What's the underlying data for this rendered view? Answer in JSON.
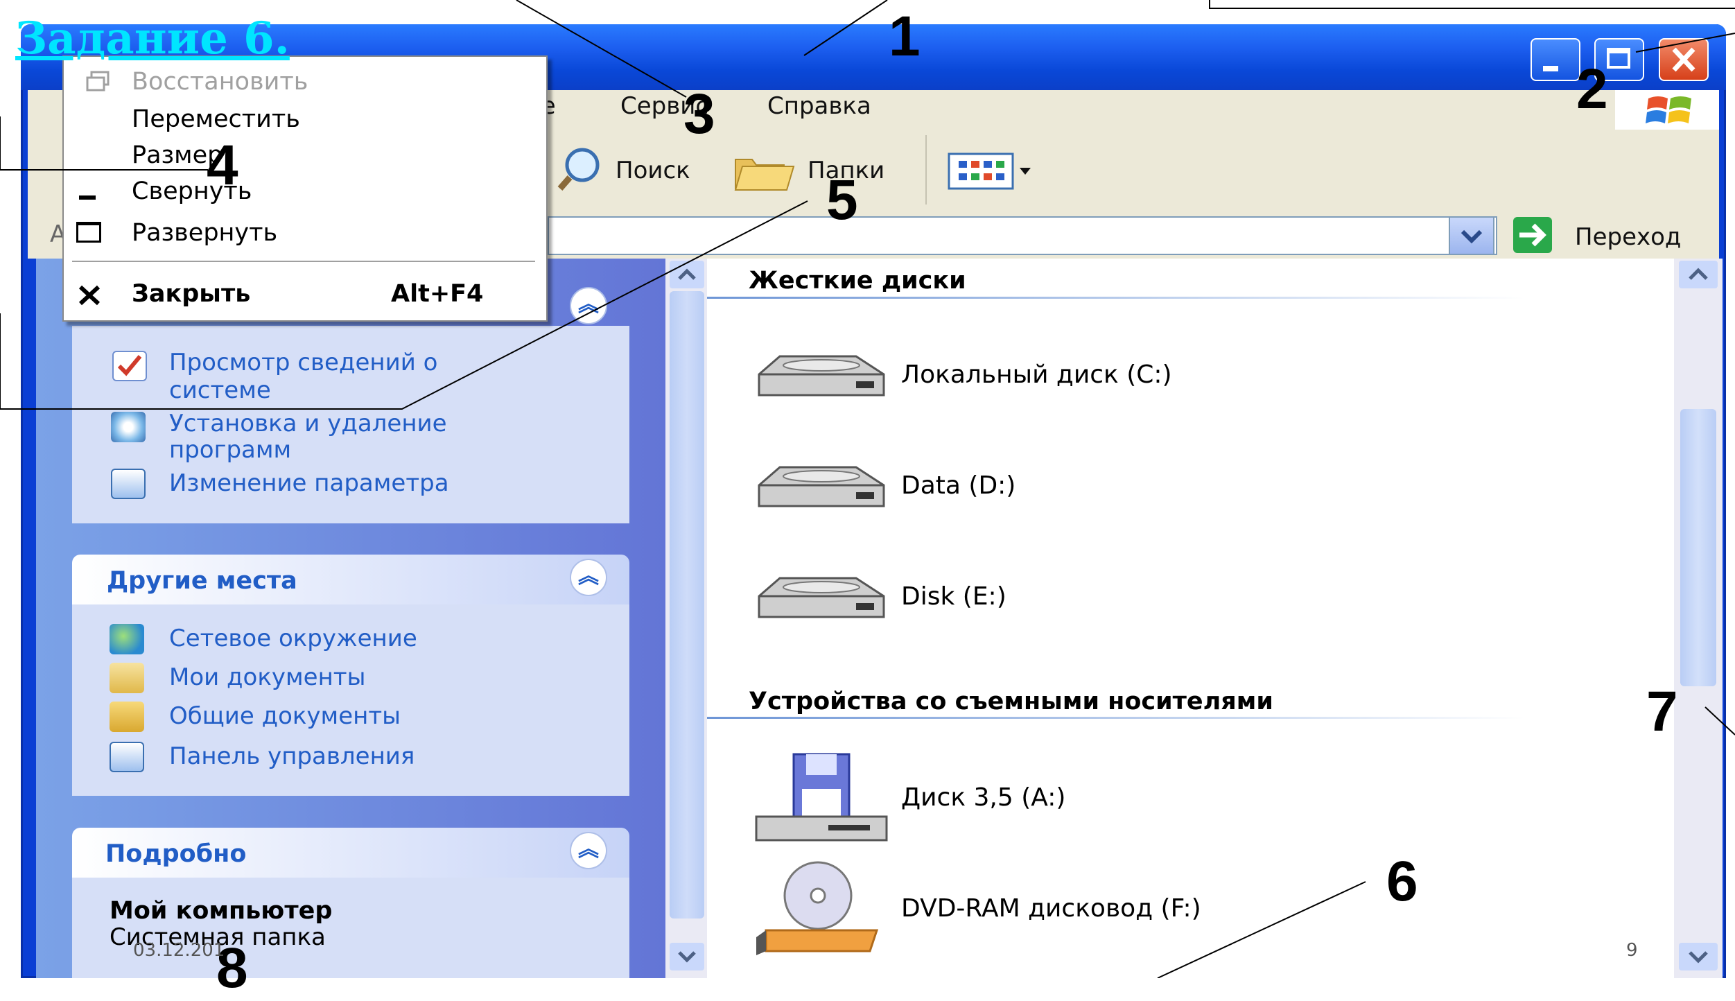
{
  "heading": "Задание 6.",
  "window": {
    "menu": [
      "ое",
      "Сервис",
      "Справка"
    ],
    "toolbar": {
      "search": "Поиск",
      "folders": "Папки"
    },
    "address": {
      "go": "Переход",
      "left_fragment": "А"
    }
  },
  "system_menu": {
    "items": [
      {
        "label": "Восстановить",
        "disabled": true,
        "icon": "restore-icon"
      },
      {
        "label": "Переместить",
        "disabled": false
      },
      {
        "label": "Размер",
        "disabled": false
      },
      {
        "label": "Свернуть",
        "disabled": false,
        "icon": "minimize-glyph"
      },
      {
        "label": "Развернуть",
        "disabled": false,
        "icon": "maximize-glyph"
      }
    ],
    "close": {
      "label": "Закрыть",
      "shortcut": "Alt+F4",
      "icon": "close-x-icon"
    }
  },
  "task_pane": {
    "system_tasks": [
      "Просмотр сведений о",
      "системе",
      "Установка и удаление",
      "программ",
      "Изменение параметра"
    ],
    "other_places": {
      "title": "Другие места",
      "items": [
        "Сетевое окружение",
        "Мои документы",
        "Общие документы",
        "Панель управления"
      ]
    },
    "details": {
      "title": "Подробно",
      "name": "Мой компьютер",
      "type": "Системная папка"
    }
  },
  "content": {
    "hard_disks_title": "Жесткие диски",
    "hard_disks": [
      "Локальный диск (C:)",
      "Data (D:)",
      "Disk (E:)"
    ],
    "removable_title": "Устройства со съемными носителями",
    "removable": [
      "Диск 3,5 (A:)",
      "DVD-RAM дисковод (F:)"
    ]
  },
  "callouts": [
    "1",
    "2",
    "3",
    "4",
    "5",
    "6",
    "7",
    "8"
  ],
  "footer": {
    "date": "03.12.201",
    "page": "9"
  },
  "colors": {
    "titlebar": "#1d5ff0",
    "taskpane": "#6f8be0",
    "link": "#215dc6",
    "heading": "#00e5ff",
    "close_button": "#e05a30"
  }
}
